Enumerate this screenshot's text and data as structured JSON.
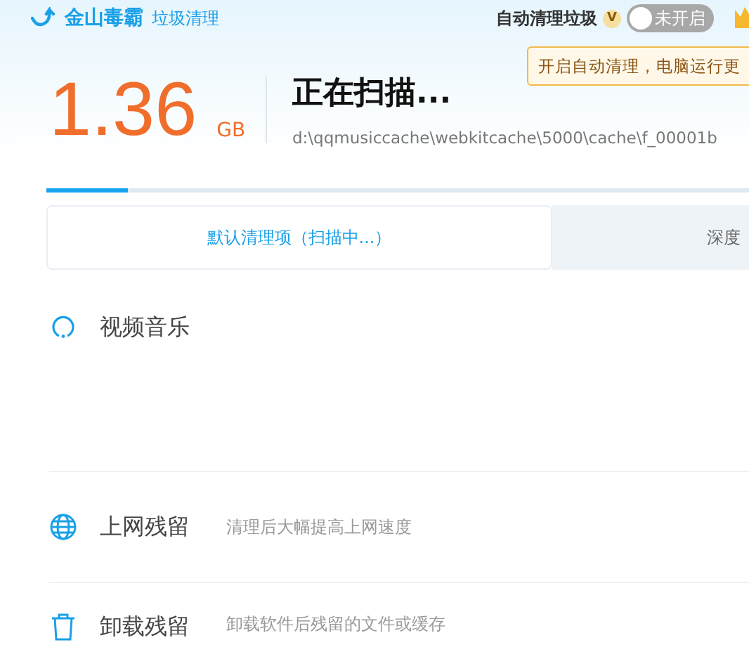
{
  "header": {
    "brand": "金山毒霸",
    "module": "垃圾清理",
    "auto_clean": {
      "label": "自动清理垃圾",
      "badge": "V",
      "toggle_text": "未开启",
      "on": false
    },
    "tooltip": "开启自动清理，电脑运行更"
  },
  "summary": {
    "size": "1.36",
    "unit": "GB",
    "status": "正在扫描...",
    "path": "d:\\qqmusiccache\\webkitcache\\5000\\cache\\f_00001b",
    "level": 0.115
  },
  "tabs": [
    {
      "label": "默认清理项（扫描中...）",
      "selected": true
    },
    {
      "label": "深度",
      "selected": false
    }
  ],
  "items": [
    {
      "kind": "scanning",
      "title": "视频音乐"
    },
    {
      "kind": "web",
      "title": "上网残留",
      "description": "清理后大幅提高上网速度"
    },
    {
      "kind": "uninstall",
      "title": "卸载残留",
      "description": "卸载软件后残留的文件或缓存"
    }
  ]
}
